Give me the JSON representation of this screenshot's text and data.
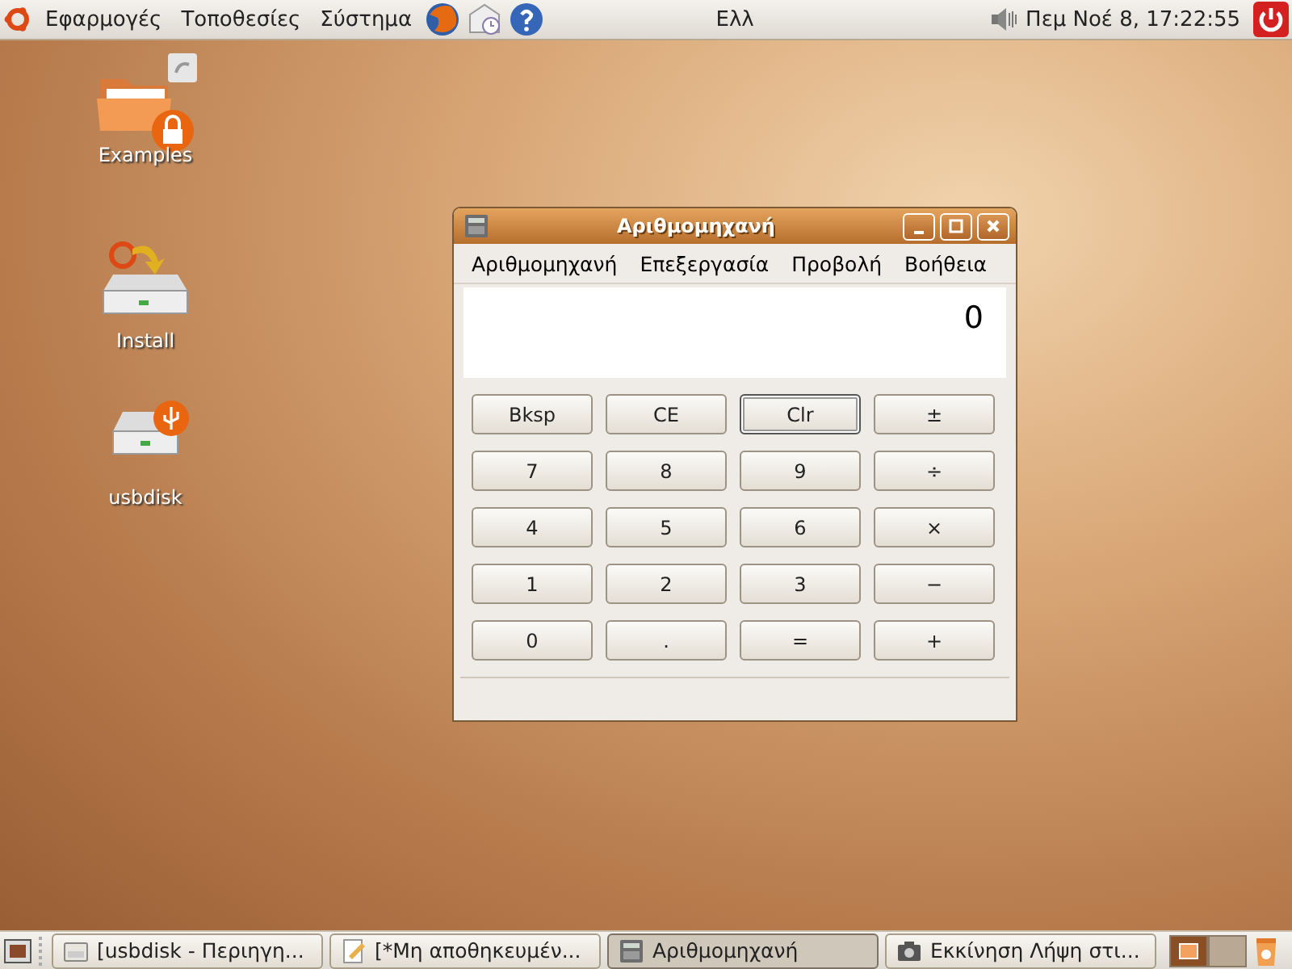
{
  "top_panel": {
    "menus": [
      "Εφαρμογές",
      "Τοποθεσίες",
      "Σύστημα"
    ],
    "keyboard_layout": "Ελλ",
    "clock": "Πεμ Νοέ  8, 17:22:55"
  },
  "desktop_icons": [
    {
      "label": "Examples",
      "kind": "folder"
    },
    {
      "label": "Install",
      "kind": "installer"
    },
    {
      "label": "usbdisk",
      "kind": "usb"
    }
  ],
  "window": {
    "title": "Αριθμομηχανή",
    "menus": [
      "Αριθμομηχανή",
      "Επεξεργασία",
      "Προβολή",
      "Βοήθεια"
    ],
    "display": "0",
    "buttons": [
      {
        "label": "Bksp",
        "focused": false
      },
      {
        "label": "CE",
        "focused": false
      },
      {
        "label": "Clr",
        "focused": true
      },
      {
        "label": "±",
        "focused": false
      },
      {
        "label": "7",
        "focused": false
      },
      {
        "label": "8",
        "focused": false
      },
      {
        "label": "9",
        "focused": false
      },
      {
        "label": "÷",
        "focused": false
      },
      {
        "label": "4",
        "focused": false
      },
      {
        "label": "5",
        "focused": false
      },
      {
        "label": "6",
        "focused": false
      },
      {
        "label": "×",
        "focused": false
      },
      {
        "label": "1",
        "focused": false
      },
      {
        "label": "2",
        "focused": false
      },
      {
        "label": "3",
        "focused": false
      },
      {
        "label": "−",
        "focused": false
      },
      {
        "label": "0",
        "focused": false
      },
      {
        "label": ".",
        "focused": false
      },
      {
        "label": "=",
        "focused": false
      },
      {
        "label": "+",
        "focused": false
      }
    ]
  },
  "taskbar": [
    {
      "label": "[usbdisk - Περιηγη...",
      "kind": "folder",
      "selected": false
    },
    {
      "label": "[*Μη αποθηκευμέν...",
      "kind": "editor",
      "selected": false
    },
    {
      "label": "Αριθμομηχανή",
      "kind": "calculator",
      "selected": true
    },
    {
      "label": "Εκκίνηση Λήψη στι...",
      "kind": "camera",
      "selected": false
    }
  ],
  "workspaces": [
    {
      "selected": true
    },
    {
      "selected": false
    }
  ]
}
